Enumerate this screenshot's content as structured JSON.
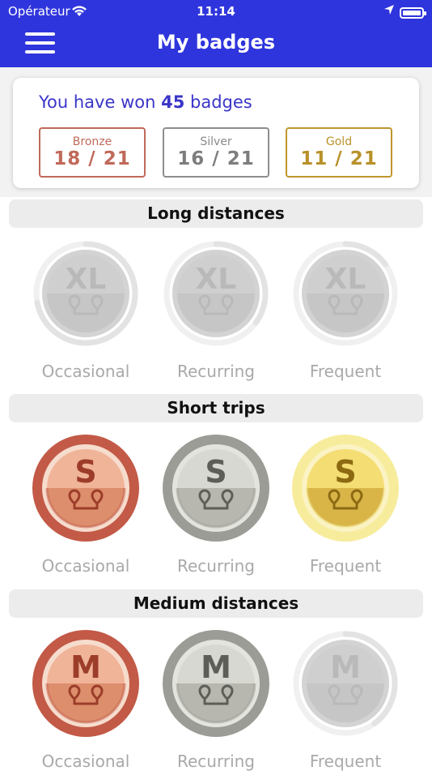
{
  "status": {
    "carrier": "Opérateur",
    "time": "11:14"
  },
  "header": {
    "title": "My badges"
  },
  "summary": {
    "won_prefix": "You have won",
    "won_count": "45",
    "won_suffix": "badges",
    "tiers": [
      {
        "label": "Bronze",
        "value": "18 / 21"
      },
      {
        "label": "Silver",
        "value": "16 / 21"
      },
      {
        "label": "Gold",
        "value": "11 / 21"
      }
    ]
  },
  "sections": [
    {
      "title": "Long distances",
      "letter": "XL",
      "badges": [
        {
          "caption": "Occasional",
          "state": "locked",
          "progress": 0.72
        },
        {
          "caption": "Recurring",
          "state": "locked",
          "progress": 0.35
        },
        {
          "caption": "Frequent",
          "state": "locked",
          "progress": 0.15
        }
      ]
    },
    {
      "title": "Short trips",
      "letter": "S",
      "badges": [
        {
          "caption": "Occasional",
          "state": "bronze",
          "progress": 1
        },
        {
          "caption": "Recurring",
          "state": "silver",
          "progress": 1
        },
        {
          "caption": "Frequent",
          "state": "gold",
          "progress": 1
        }
      ]
    },
    {
      "title": "Medium distances",
      "letter": "M",
      "badges": [
        {
          "caption": "Occasional",
          "state": "bronze",
          "progress": 1
        },
        {
          "caption": "Recurring",
          "state": "silver",
          "progress": 1
        },
        {
          "caption": "Frequent",
          "state": "locked",
          "progress": 0.4
        }
      ]
    }
  ],
  "colors": {
    "header": "#2f35dc",
    "bronze": "#c0614f",
    "silver": "#9a9a94",
    "gold": "#f3e27a",
    "locked": "#d8d8d8"
  }
}
